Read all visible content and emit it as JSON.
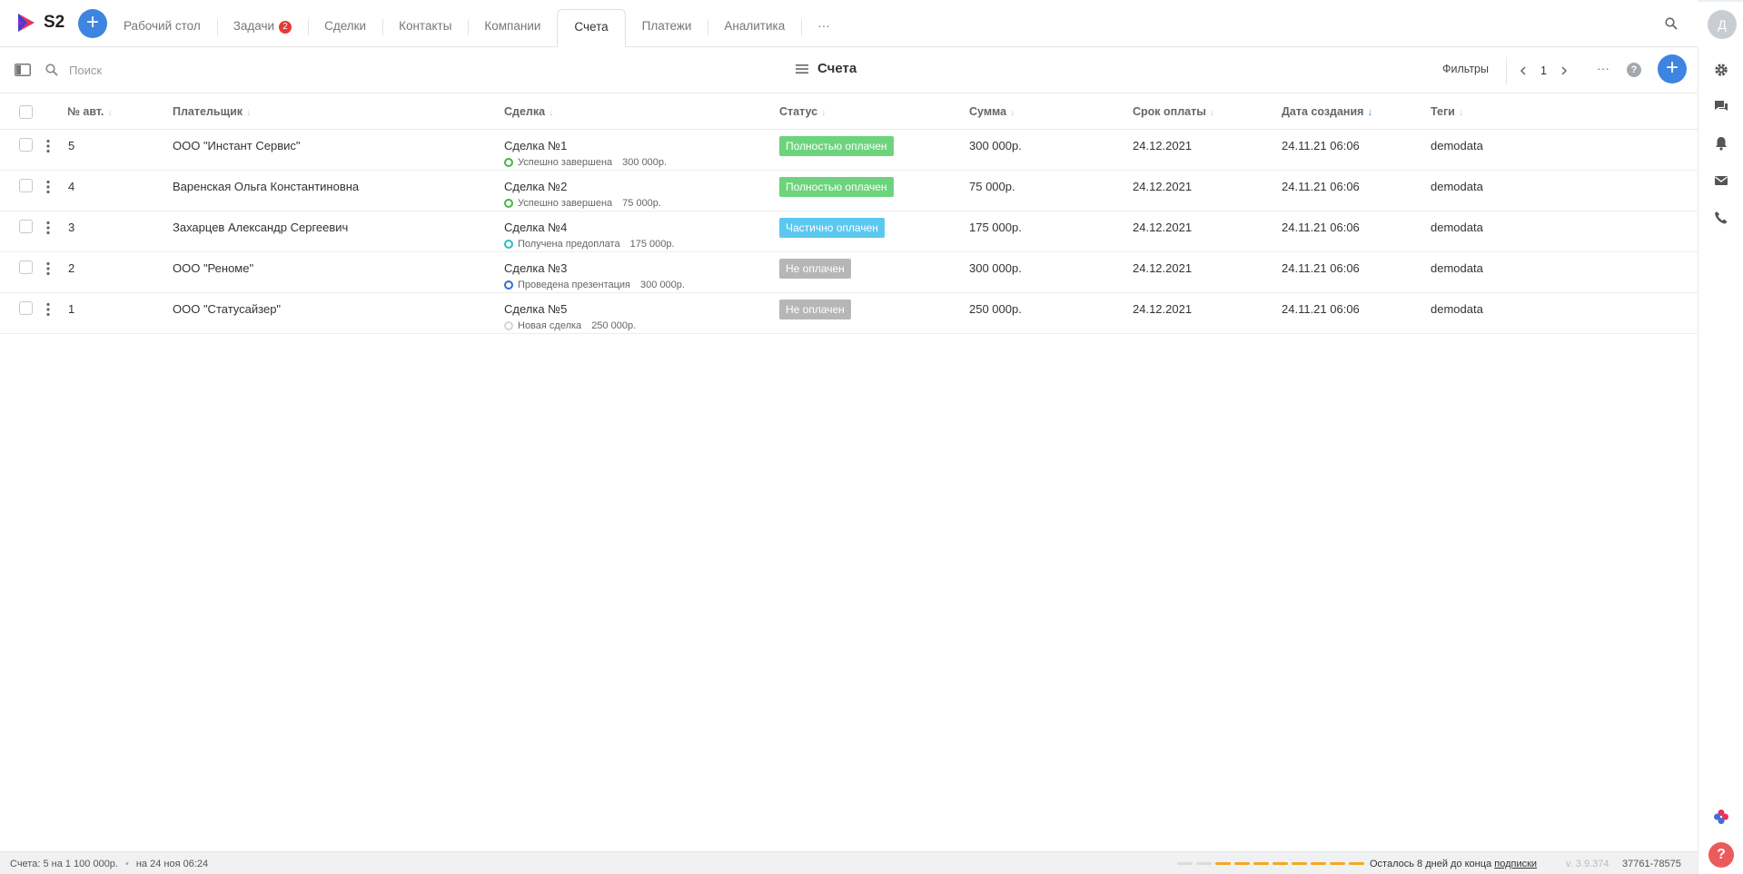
{
  "app": {
    "logo_text": "S2"
  },
  "nav": {
    "add_label": "+",
    "tabs": [
      {
        "label": "Рабочий стол",
        "badge": ""
      },
      {
        "label": "Задачи",
        "badge": "2"
      },
      {
        "label": "Сделки",
        "badge": ""
      },
      {
        "label": "Контакты",
        "badge": ""
      },
      {
        "label": "Компании",
        "badge": ""
      },
      {
        "label": "Счета",
        "badge": "",
        "active": true
      },
      {
        "label": "Платежи",
        "badge": ""
      },
      {
        "label": "Аналитика",
        "badge": ""
      },
      {
        "label": "···",
        "badge": ""
      }
    ],
    "avatar_initial": "Д"
  },
  "toolbar": {
    "search_placeholder": "Поиск",
    "title": "Счета",
    "filters_label": "Фильтры",
    "page": "1",
    "more_label": "···",
    "help_label": "?",
    "add_label": "+"
  },
  "table": {
    "columns": [
      {
        "key": "num",
        "label": "№ авт."
      },
      {
        "key": "payer",
        "label": "Плательщик"
      },
      {
        "key": "deal",
        "label": "Сделка"
      },
      {
        "key": "status",
        "label": "Статус"
      },
      {
        "key": "sum",
        "label": "Сумма"
      },
      {
        "key": "due",
        "label": "Срок оплаты"
      },
      {
        "key": "created",
        "label": "Дата создания",
        "sorted": "desc"
      },
      {
        "key": "tags",
        "label": "Теги"
      }
    ],
    "rows": [
      {
        "num": "5",
        "payer": "ООО \"Инстант Сервис\"",
        "deal": "Сделка №1",
        "deal_stage": "Успешно завершена",
        "deal_stage_color": "#43b649",
        "deal_amount": "300 000р.",
        "status": "Полностью оплачен",
        "status_color": "#6cd47c",
        "sum": "300 000р.",
        "due": "24.12.2021",
        "created": "24.11.21 06:06",
        "tags": "demodata"
      },
      {
        "num": "4",
        "payer": "Варенская Ольга Константиновна",
        "deal": "Сделка №2",
        "deal_stage": "Успешно завершена",
        "deal_stage_color": "#43b649",
        "deal_amount": "75 000р.",
        "status": "Полностью оплачен",
        "status_color": "#6cd47c",
        "sum": "75 000р.",
        "due": "24.12.2021",
        "created": "24.11.21 06:06",
        "tags": "demodata"
      },
      {
        "num": "3",
        "payer": "Захарцев Александр Сергеевич",
        "deal": "Сделка №4",
        "deal_stage": "Получена предоплата",
        "deal_stage_color": "#27bcc9",
        "deal_amount": "175 000р.",
        "status": "Частично оплачен",
        "status_color": "#5bc8f0",
        "sum": "175 000р.",
        "due": "24.12.2021",
        "created": "24.11.21 06:06",
        "tags": "demodata"
      },
      {
        "num": "2",
        "payer": "ООО \"Реноме\"",
        "deal": "Сделка №3",
        "deal_stage": "Проведена презентация",
        "deal_stage_color": "#2f6fd6",
        "deal_amount": "300 000р.",
        "status": "Не оплачен",
        "status_color": "#b6b6b6",
        "sum": "300 000р.",
        "due": "24.12.2021",
        "created": "24.11.21 06:06",
        "tags": "demodata"
      },
      {
        "num": "1",
        "payer": "ООО \"Статусайзер\"",
        "deal": "Сделка №5",
        "deal_stage": "Новая сделка",
        "deal_stage_color": "#d6d6d6",
        "deal_amount": "250 000р.",
        "status": "Не оплачен",
        "status_color": "#b6b6b6",
        "sum": "250 000р.",
        "due": "24.12.2021",
        "created": "24.11.21 06:06",
        "tags": "demodata"
      }
    ]
  },
  "footer": {
    "summary": "Счета: 5 на 1 100 000р.",
    "updated": "на 24 ноя 06:24",
    "remaining_text": "Осталось 8 дней до конца",
    "remaining_link": "подписки",
    "version": "v. 3.9.374",
    "code": "37761-78575",
    "progress_colors": [
      "#dcdcdc",
      "#dcdcdc",
      "#f5a623",
      "#f5a623",
      "#f5a623",
      "#f5a623",
      "#f5a623",
      "#f5a623",
      "#f5a623",
      "#f5a623"
    ]
  },
  "rail": {
    "help_label": "?"
  },
  "colors": {
    "accent": "#3d85e0",
    "danger": "#e53935"
  }
}
